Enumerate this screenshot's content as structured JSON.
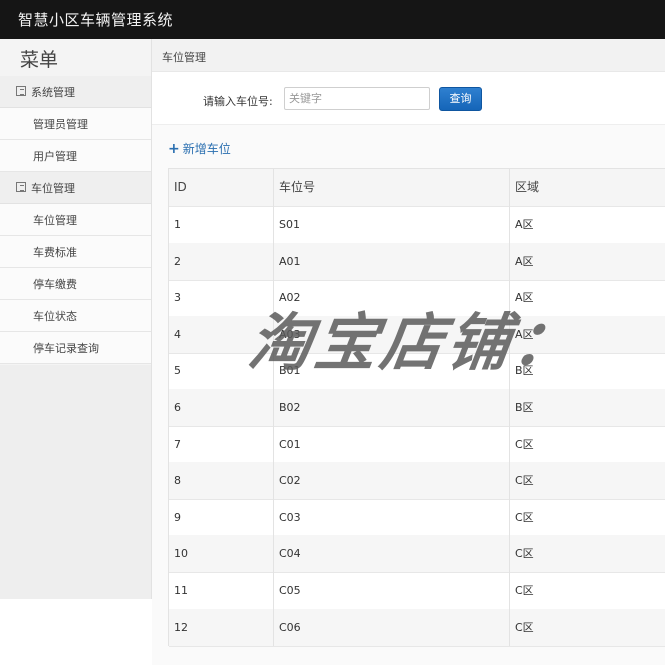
{
  "app": {
    "title": "智慧小区车辆管理系统"
  },
  "sidebar": {
    "menu_title": "菜单",
    "sections": [
      {
        "label": "系统管理",
        "items": [
          "管理员管理",
          "用户管理"
        ]
      },
      {
        "label": "车位管理",
        "items": [
          "车位管理",
          "车费标准",
          "停车缴费",
          "车位状态",
          "停车记录查询"
        ]
      }
    ]
  },
  "main": {
    "breadcrumb": "车位管理",
    "search": {
      "label": "请输入车位号:",
      "placeholder": "关键字",
      "button": "查询"
    },
    "add_link": "新增车位",
    "table": {
      "headers": [
        "ID",
        "车位号",
        "区域"
      ],
      "rows": [
        [
          "1",
          "S01",
          "A区"
        ],
        [
          "2",
          "A01",
          "A区"
        ],
        [
          "3",
          "A02",
          "A区"
        ],
        [
          "4",
          "A03",
          "A区"
        ],
        [
          "5",
          "B01",
          "B区"
        ],
        [
          "6",
          "B02",
          "B区"
        ],
        [
          "7",
          "C01",
          "C区"
        ],
        [
          "8",
          "C02",
          "C区"
        ],
        [
          "9",
          "C03",
          "C区"
        ],
        [
          "10",
          "C04",
          "C区"
        ],
        [
          "11",
          "C05",
          "C区"
        ],
        [
          "12",
          "C06",
          "C区"
        ]
      ]
    }
  },
  "watermark": "淘宝店铺：",
  "icons": {
    "section_icon": "list-icon",
    "add_icon": "plus-icon"
  },
  "colors": {
    "topbar": "#151515",
    "primary_button": "#1f72c4",
    "link": "#2a6fb0"
  }
}
